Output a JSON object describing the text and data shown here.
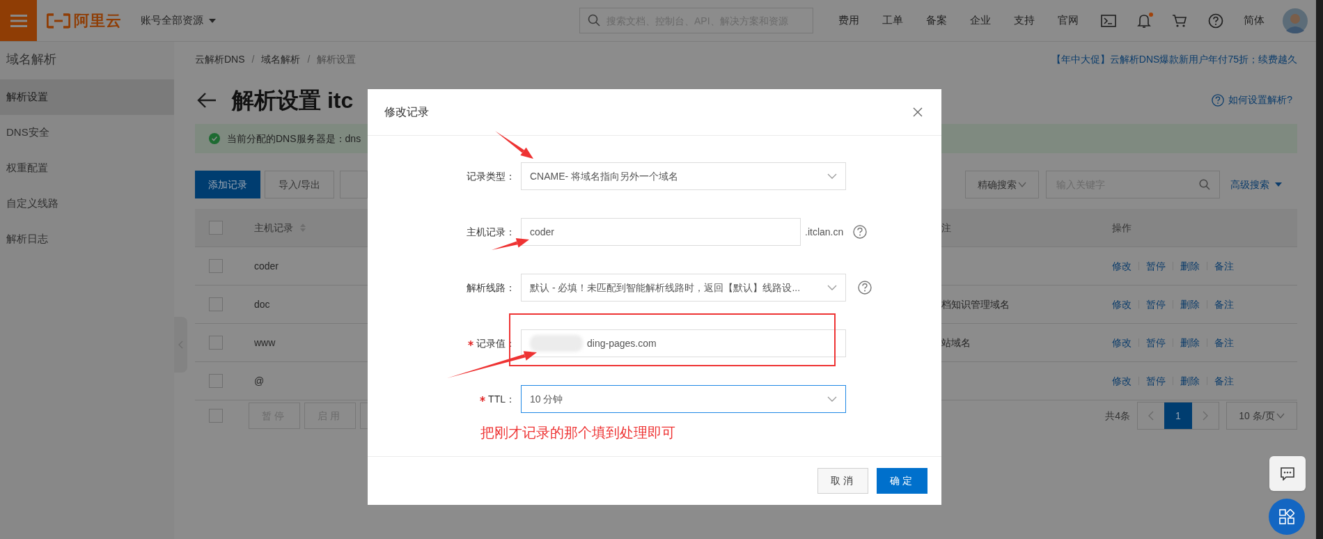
{
  "top_bar": {
    "logo_text": "阿里云",
    "account_menu": "账号全部资源",
    "search_placeholder": "搜索文档、控制台、API、解决方案和资源",
    "nav": [
      "费用",
      "工单",
      "备案",
      "企业",
      "支持",
      "官网"
    ],
    "has_unread": true,
    "language": "简体"
  },
  "sidebar": {
    "title": "域名解析",
    "items": [
      {
        "label": "解析设置",
        "selected": true
      },
      {
        "label": "DNS安全",
        "selected": false
      },
      {
        "label": "权重配置",
        "selected": false
      },
      {
        "label": "自定义线路",
        "selected": false
      },
      {
        "label": "解析日志",
        "selected": false
      }
    ]
  },
  "breadcrumb": {
    "items": [
      "云解析DNS",
      "域名解析",
      "解析设置"
    ],
    "separator": "/"
  },
  "promo": "【年中大促】云解析DNS爆款新用户年付75折；续费越久",
  "page_title": "解析设置 itc",
  "help_link": "如何设置解析?",
  "notice": "当前分配的DNS服务器是：dns",
  "toolbar": {
    "buttons": [
      {
        "label": "添加记录",
        "primary": true
      },
      {
        "label": "导入/导出",
        "primary": false
      }
    ],
    "search_mode": "精确搜索",
    "search_placeholder": "输入关键字",
    "advanced": "高级搜索"
  },
  "table": {
    "columns": [
      "主机记录",
      "注",
      "操作"
    ],
    "header_checked": false,
    "rows": [
      {
        "host": "coder",
        "checked": false,
        "actions": [
          "修改",
          "暂停",
          "删除",
          "备注"
        ]
      },
      {
        "host": "doc",
        "checked": false,
        "remark": "档知识管理域名",
        "actions": [
          "修改",
          "暂停",
          "删除",
          "备注"
        ]
      },
      {
        "host": "www",
        "checked": false,
        "remark": "站域名",
        "actions": [
          "修改",
          "暂停",
          "删除",
          "备注"
        ]
      },
      {
        "host": "@",
        "checked": false,
        "actions": [
          "修改",
          "暂停",
          "删除",
          "备注"
        ]
      }
    ]
  },
  "footer": {
    "checked": false,
    "buttons": [
      "暂停",
      "启用"
    ],
    "total": "共4条",
    "pages": [
      {
        "label": "1",
        "selected": true
      }
    ],
    "page_size": "10 条/页"
  },
  "dialog": {
    "title": "修改记录",
    "fields": [
      {
        "kind": "select",
        "label": "记录类型：",
        "value": "CNAME- 将域名指向另外一个域名",
        "required": false,
        "help": false,
        "redacted": false,
        "focused": false,
        "highlighted": false
      },
      {
        "kind": "input",
        "label": "主机记录：",
        "value": "coder",
        "suffix": ".itclan.cn",
        "required": false,
        "help": true,
        "redacted": false,
        "focused": false,
        "highlighted": false
      },
      {
        "kind": "select",
        "label": "解析线路：",
        "value": "默认 - 必填！未匹配到智能解析线路时，返回【默认】线路设...",
        "required": false,
        "help": true,
        "redacted": false,
        "focused": false,
        "highlighted": false
      },
      {
        "kind": "input",
        "label": "记录值：",
        "value": "ding-pages.com",
        "required": true,
        "help": false,
        "redacted": true,
        "focused": false,
        "highlighted": true
      },
      {
        "kind": "select",
        "label": "TTL：",
        "value": "10 分钟",
        "required": true,
        "help": false,
        "redacted": false,
        "focused": true,
        "highlighted": false
      }
    ],
    "buttons": [
      {
        "label": "取消",
        "primary": false
      },
      {
        "label": "确定",
        "primary": true
      }
    ]
  },
  "annotation": "把刚才记录的那个填到处理即可"
}
